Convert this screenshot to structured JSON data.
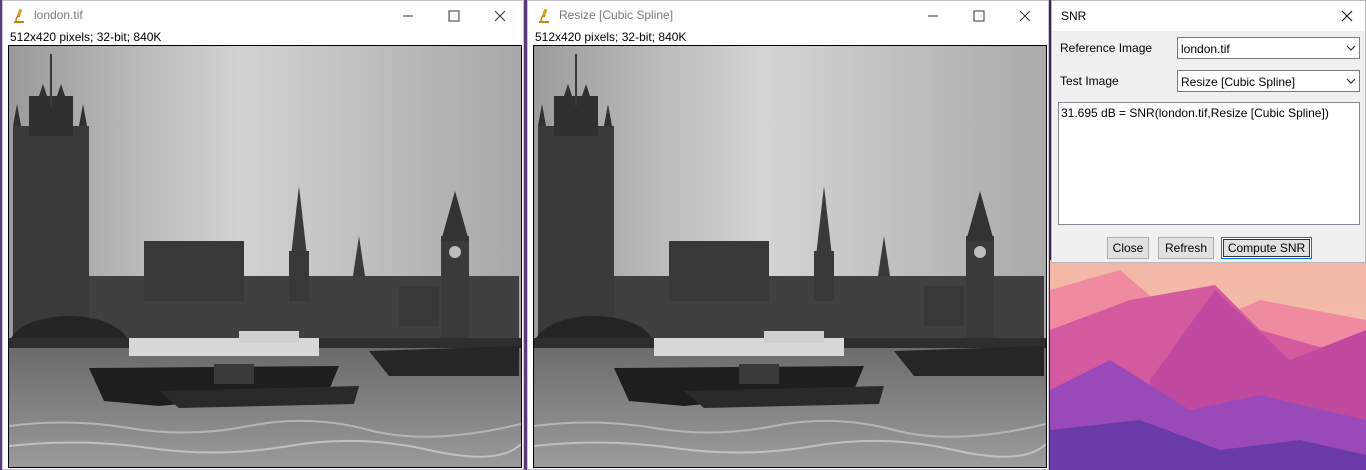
{
  "windows": [
    {
      "title": "london.tif",
      "info": "512x420 pixels; 32-bit; 840K"
    },
    {
      "title": "Resize [Cubic Spline]",
      "info": "512x420 pixels; 32-bit; 840K"
    }
  ],
  "snr_dialog": {
    "title": "SNR",
    "reference_label": "Reference Image",
    "reference_value": "london.tif",
    "test_label": "Test Image",
    "test_value": "Resize [Cubic Spline]",
    "result_text": "31.695 dB = SNR(london.tif,Resize [Cubic Spline])",
    "close_label": "Close",
    "refresh_label": "Refresh",
    "compute_label": "Compute SNR"
  },
  "icons": {
    "app": "microscope-icon",
    "minimize": "minimize-icon",
    "maximize": "maximize-icon",
    "close": "close-icon",
    "dropdown": "chevron-down-icon"
  },
  "colors": {
    "wallpaper_pink": "#e87aa8",
    "wallpaper_purple": "#7a4aa8",
    "button_focus": "#0078d7"
  }
}
